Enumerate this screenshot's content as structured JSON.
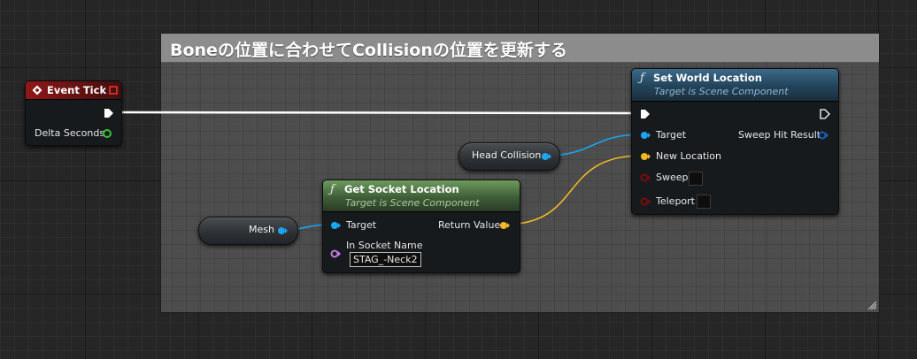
{
  "comment": {
    "title": "Boneの位置に合わせてCollisionの位置を更新する"
  },
  "event_tick": {
    "title": "Event Tick",
    "delta_seconds_label": "Delta Seconds",
    "colors": {
      "header": "#7a1414",
      "exec_pin": "#ffffff",
      "float_pin": "#35c22f"
    }
  },
  "set_world_location": {
    "title": "Set World Location",
    "subtitle": "Target is Scene Component",
    "pins": {
      "target": "Target",
      "new_location": "New Location",
      "sweep": "Sweep",
      "teleport": "Teleport",
      "sweep_hit_result": "Sweep Hit Result"
    },
    "colors": {
      "header": "#2f5570"
    }
  },
  "get_socket_location": {
    "title": "Get Socket Location",
    "subtitle": "Target is Scene Component",
    "pins": {
      "target": "Target",
      "return_value": "Return Value",
      "in_socket_name": "In Socket Name"
    },
    "socket_name_value": "STAG_-Neck2",
    "colors": {
      "header": "#4a6b3f"
    }
  },
  "head_collision": {
    "label": "Head Collision"
  },
  "mesh": {
    "label": "Mesh"
  },
  "pin_colors": {
    "object": "#1aa6f0",
    "vector": "#f0b824",
    "bool": "#7a0b0b",
    "name": "#c07ae0",
    "struct": "#1a5fb0"
  }
}
